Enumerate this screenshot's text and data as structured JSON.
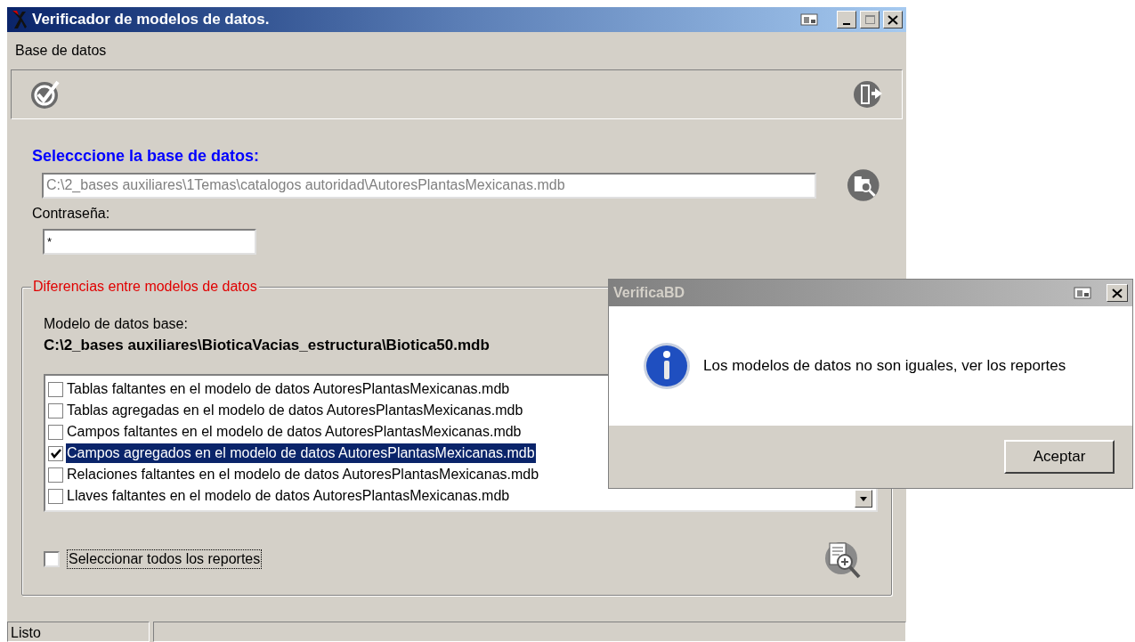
{
  "window": {
    "title": "Verificador de modelos de datos."
  },
  "menu": [
    {
      "label": "Base de datos"
    }
  ],
  "database": {
    "label": "Selecccione la base de datos:",
    "value": "C:\\2_bases auxiliares\\1Temas\\catalogos autoridad\\AutoresPlantasMexicanas.mdb"
  },
  "password": {
    "label": "Contraseña:",
    "value": "*"
  },
  "group": {
    "title": "Diferencias entre modelos de datos",
    "base_label": "Modelo de datos base:",
    "base_path": "C:\\2_bases auxiliares\\BioticaVacias_estructura\\Biotica50.mdb",
    "reports": [
      {
        "label": "Tablas faltantes en el modelo de datos AutoresPlantasMexicanas.mdb",
        "checked": false,
        "selected": false
      },
      {
        "label": "Tablas agregadas en el modelo de datos AutoresPlantasMexicanas.mdb",
        "checked": false,
        "selected": false
      },
      {
        "label": "Campos faltantes en el modelo de datos AutoresPlantasMexicanas.mdb",
        "checked": false,
        "selected": false
      },
      {
        "label": "Campos agregados en el modelo de datos AutoresPlantasMexicanas.mdb",
        "checked": true,
        "selected": true
      },
      {
        "label": "Relaciones faltantes en el modelo de datos AutoresPlantasMexicanas.mdb",
        "checked": false,
        "selected": false
      },
      {
        "label": "Llaves faltantes en el modelo de datos AutoresPlantasMexicanas.mdb",
        "checked": false,
        "selected": false
      }
    ],
    "select_all": {
      "label": "Seleccionar todos los reportes",
      "checked": false
    }
  },
  "status_bar": [
    "Listo"
  ],
  "dialog": {
    "title": "VerificaBD",
    "message": "Los modelos de datos no son iguales, ver los reportes",
    "buttons": [
      "Aceptar"
    ]
  }
}
